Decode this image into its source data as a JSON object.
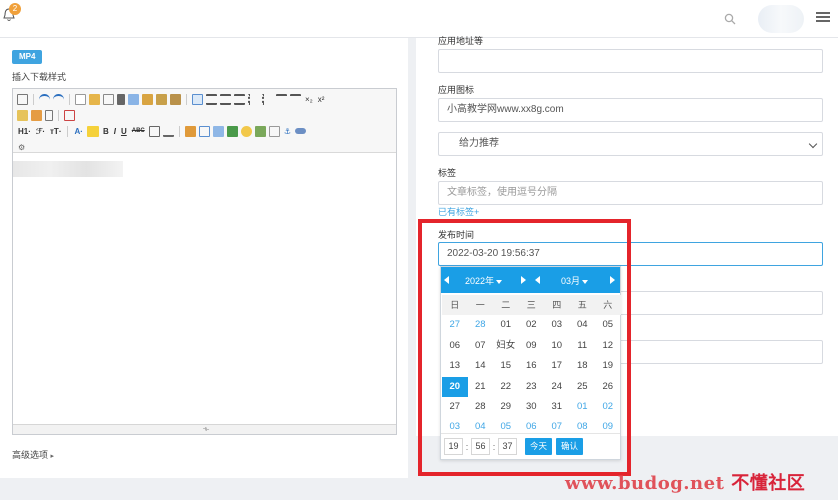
{
  "topbar": {
    "notification_count": "2",
    "icons": [
      "bell-icon",
      "search-icon",
      "menu-icon"
    ]
  },
  "left": {
    "mp4_tag": "MP4",
    "insert_label": "插入下载样式",
    "toolbar": {
      "heading": "H1·",
      "font_family": "ℱ·",
      "font_size": "тT·",
      "font_color": "A·",
      "bold": "B",
      "italic": "I",
      "underline": "U",
      "strike": "ABC"
    },
    "advanced_options": "高级选项"
  },
  "right": {
    "app_address_label": "应用地址等",
    "app_icon_label": "应用图标",
    "app_icon_value": "小高教学网www.xx8g.com",
    "recommend_select": "给力推荐",
    "tags_label": "标签",
    "tags_placeholder": "文章标签，使用逗号分隔",
    "tags_existing": "已有标签+",
    "publish_label": "发布时间",
    "publish_value": "2022-03-20 19:56:37"
  },
  "datepicker": {
    "year": "2022年",
    "month": "03月",
    "weekdays": [
      "日",
      "一",
      "二",
      "三",
      "四",
      "五",
      "六"
    ],
    "days": [
      {
        "t": "27",
        "o": true
      },
      {
        "t": "28",
        "o": true
      },
      {
        "t": "01"
      },
      {
        "t": "02"
      },
      {
        "t": "03"
      },
      {
        "t": "04"
      },
      {
        "t": "05"
      },
      {
        "t": "06"
      },
      {
        "t": "07"
      },
      {
        "t": "妇女"
      },
      {
        "t": "09"
      },
      {
        "t": "10"
      },
      {
        "t": "11"
      },
      {
        "t": "12"
      },
      {
        "t": "13"
      },
      {
        "t": "14"
      },
      {
        "t": "15"
      },
      {
        "t": "16"
      },
      {
        "t": "17"
      },
      {
        "t": "18"
      },
      {
        "t": "19"
      },
      {
        "t": "20",
        "sel": true
      },
      {
        "t": "21"
      },
      {
        "t": "22"
      },
      {
        "t": "23"
      },
      {
        "t": "24"
      },
      {
        "t": "25"
      },
      {
        "t": "26"
      },
      {
        "t": "27"
      },
      {
        "t": "28"
      },
      {
        "t": "29"
      },
      {
        "t": "30"
      },
      {
        "t": "31"
      },
      {
        "t": "01",
        "o": true
      },
      {
        "t": "02",
        "o": true
      },
      {
        "t": "03",
        "o": true
      },
      {
        "t": "04",
        "o": true
      },
      {
        "t": "05",
        "o": true
      },
      {
        "t": "06",
        "o": true
      },
      {
        "t": "07",
        "o": true
      },
      {
        "t": "08",
        "o": true
      },
      {
        "t": "09",
        "o": true
      }
    ],
    "hour": "19",
    "minute": "56",
    "second": "37",
    "today_btn": "今天",
    "confirm_btn": "确认"
  },
  "watermark": {
    "url": "www.budog.net",
    "cn": "不懂社区"
  },
  "colors": {
    "accent": "#1a9ee6",
    "highlight_border": "#e4242b",
    "badge": "#f0a03a"
  }
}
